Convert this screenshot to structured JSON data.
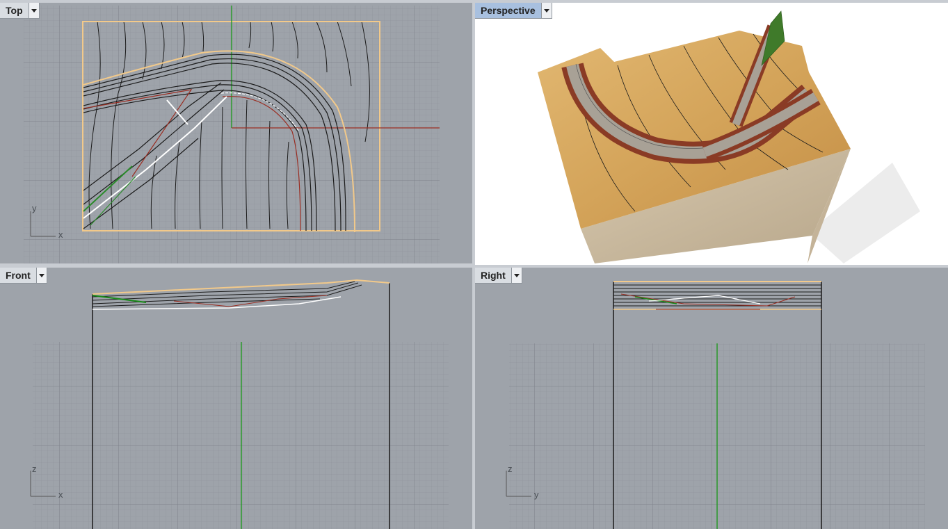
{
  "viewports": {
    "top": {
      "title": "Top",
      "axis_h": "x",
      "axis_v": "y"
    },
    "persp": {
      "title": "Perspective"
    },
    "front": {
      "title": "Front",
      "axis_h": "x",
      "axis_v": "z"
    },
    "right": {
      "title": "Right",
      "axis_h": "y",
      "axis_v": "z"
    }
  },
  "colors": {
    "viewport_bg": "#9ea3aa",
    "grid_minor": "#8d9299",
    "grid_major": "#7d828a",
    "active_tab": "#a8c0df",
    "x_axis": "#9a2d22",
    "y_axis": "#1a9a1a",
    "boundary": "#f2c98a",
    "terrain": "#d8a95e",
    "soil": "#cdbda3",
    "path": "#a8a196",
    "brick": "#8a3b25"
  },
  "icons": {
    "dropdown": "chevron-down-icon",
    "axis_gizmo": "axis-gizmo-icon"
  }
}
